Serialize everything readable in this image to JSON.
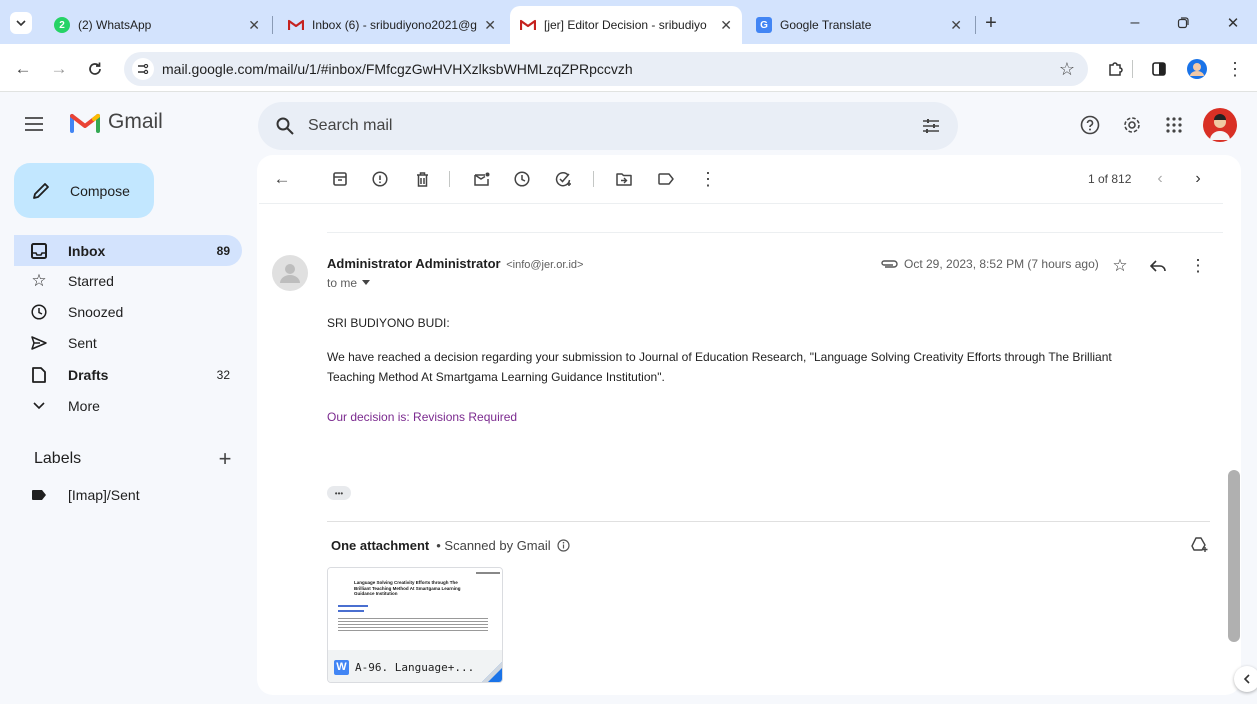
{
  "browser": {
    "tabs": [
      {
        "title": "(2) WhatsApp",
        "badge": "2"
      },
      {
        "title": "Inbox (6) - sribudiyono2021@g"
      },
      {
        "title": "[jer] Editor Decision - sribudiyo"
      },
      {
        "title": "Google Translate"
      }
    ],
    "url": "mail.google.com/mail/u/1/#inbox/FMfcgzGwHVHXzlksbWHMLzqZPRpccvzh"
  },
  "gmail": {
    "logo_text": "Gmail",
    "search_placeholder": "Search mail",
    "compose_label": "Compose",
    "nav": [
      {
        "label": "Inbox",
        "count": "89",
        "icon": "inbox-icon"
      },
      {
        "label": "Starred",
        "count": "",
        "icon": "star-icon"
      },
      {
        "label": "Snoozed",
        "count": "",
        "icon": "clock-icon"
      },
      {
        "label": "Sent",
        "count": "",
        "icon": "send-icon"
      },
      {
        "label": "Drafts",
        "count": "32",
        "icon": "draft-icon"
      },
      {
        "label": "More",
        "count": "",
        "icon": "chevron-down-icon"
      }
    ],
    "labels_heading": "Labels",
    "labels": [
      {
        "label": "[Imap]/Sent"
      }
    ],
    "pagination": "1 of 812"
  },
  "email": {
    "sender_name": "Administrator Administrator",
    "sender_email": "<info@jer.or.id>",
    "to_line": "to me",
    "date": "Oct 29, 2023, 8:52 PM (7 hours ago)",
    "greeting": "SRI BUDIYONO BUDI:",
    "body1": "We have reached a decision regarding your submission to Journal of Education Research, \"Language Solving Creativity Efforts through The Brilliant",
    "body2": "Teaching Method At Smartgama Learning Guidance Institution\".",
    "decision": "Our decision is: Revisions Required",
    "ellipsis": "•••",
    "attachment_heading": "One attachment",
    "scanned_text": "• Scanned by Gmail",
    "attachment_name": "A-96. Language+...",
    "attachment_preview_title": "Language Solving Creativity Efforts through The Brilliant Teaching Method At Smartgama Learning Guidance Institution",
    "word_letter": "W"
  },
  "colors": {
    "accent_blue": "#0b57d0",
    "compose_bg": "#c2e7ff",
    "active_nav_bg": "#d3e3fd",
    "decision_purple": "#7b2a8f"
  }
}
